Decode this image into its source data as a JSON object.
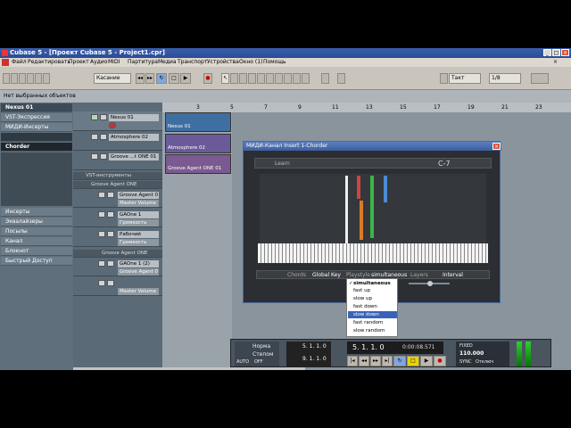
{
  "window": {
    "title": "Cubase 5 - [Проект Cubase 5 - Project1.cpr]"
  },
  "menu": [
    "Файл",
    "Редактировать",
    "Проект",
    "Аудио",
    "MIDI",
    "Партитура",
    "Медиа",
    "Транспорт",
    "Устройства",
    "Окно (1)",
    "Помощь"
  ],
  "toolbar": {
    "mode": "Касание",
    "snap": "Такт",
    "quant": "1/8"
  },
  "info_line": "Нет выбранных объектов",
  "inspector": {
    "track": "Nexus 01",
    "rows": [
      "VST-Экспрессия",
      "МИДИ-Инсерты",
      "Chorder",
      "Инсерты",
      "Эквалайзеры",
      "Посылы",
      "Канал",
      "Блокнот",
      "Быстрый Доступ"
    ]
  },
  "tracks": [
    {
      "name": "Nexus 01"
    },
    {
      "name": "Atmosphere 02"
    },
    {
      "name": "Groove ...t ONE 01"
    },
    {
      "name": "VST-инструменты"
    },
    {
      "name": "Groove Agent ONE"
    },
    {
      "name": "Groove Agent 0"
    },
    {
      "name": "Master Volume"
    },
    {
      "name": "GAOne 1"
    },
    {
      "name": "Громкость"
    },
    {
      "name": "Рабочий"
    },
    {
      "name": "Громкость"
    },
    {
      "name": "Groove Agent ONE"
    },
    {
      "name": "GAOne 1 (2)"
    },
    {
      "name": "Groove Agent 0"
    },
    {
      "name": "Master Volume"
    }
  ],
  "ruler": [
    "3",
    "5",
    "7",
    "9",
    "11",
    "13",
    "15",
    "17",
    "19",
    "21",
    "23"
  ],
  "clips": [
    "Nexus 01",
    "Atmosphere 02",
    "Groove Agent ONE 01"
  ],
  "plugin": {
    "title": "МИДИ-Канал Insert 1-Chorder",
    "learn": "Learn",
    "chord": "C-7",
    "chords_label": "Chords",
    "chords_value": "Global Key",
    "playstyle_label": "Playstyle",
    "playstyle_value": "simultaneous",
    "layers_label": "Layers",
    "layers_value": "Interval"
  },
  "dropdown": [
    {
      "label": "simultaneous",
      "checked": true
    },
    {
      "label": "fast up"
    },
    {
      "label": "slow up"
    },
    {
      "label": "fast down"
    },
    {
      "label": "slow down",
      "highlighted": true
    },
    {
      "label": "fast random"
    },
    {
      "label": "slow random"
    }
  ],
  "transport": {
    "norm_label": "Норма",
    "steps_label": "Степом",
    "auto": "AUTO",
    "off": "OFF",
    "pos_left": "5.  1.  1.   0",
    "pos_right": "9.  1.  1.   0",
    "pos_main": "5.  1.  1.   0",
    "pos_time": "0:00:08.571",
    "tempo": "110.000",
    "fixed": "FIXED",
    "sync": "SYNC",
    "sync_val": "Отключ"
  }
}
